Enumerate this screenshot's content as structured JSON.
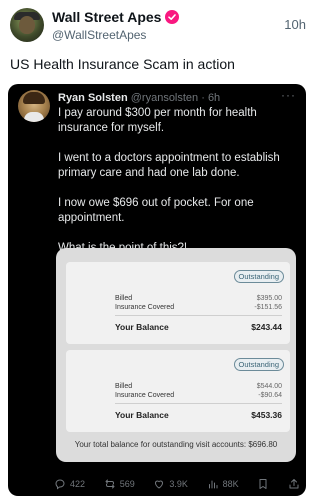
{
  "outer_post": {
    "name": "Wall Street Apes",
    "handle": "@WallStreetApes",
    "time": "10h",
    "text": "US Health Insurance Scam in action"
  },
  "quoted": {
    "name": "Ryan Solsten",
    "handle_time": "@ryansolsten · 6h",
    "more": "···",
    "paragraphs": [
      "I pay around $300 per month for health insurance for myself.",
      "I went to a doctors appointment to establish primary care and had one lab done.",
      "I now owe $696 out of pocket. For one appointment.",
      "What is the point of this?!"
    ]
  },
  "receipt": {
    "panels": [
      {
        "badge": "Outstanding",
        "billed_label": "Billed",
        "billed": "$395.00",
        "covered_label": "Insurance Covered",
        "covered": "-$151.56",
        "balance_label": "Your Balance",
        "balance": "$243.44"
      },
      {
        "badge": "Outstanding",
        "billed_label": "Billed",
        "billed": "$544.00",
        "covered_label": "Insurance Covered",
        "covered": "-$90.64",
        "balance_label": "Your Balance",
        "balance": "$453.36"
      }
    ],
    "total": "Your total balance for outstanding visit accounts: $696.80"
  },
  "actions": {
    "replies": "422",
    "reposts": "569",
    "likes": "3.9K",
    "views": "88K"
  }
}
